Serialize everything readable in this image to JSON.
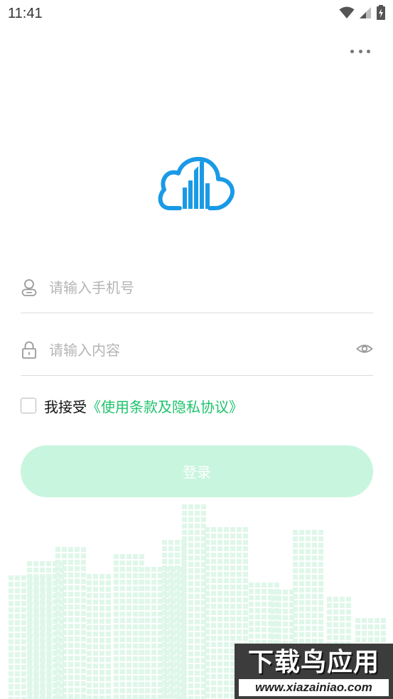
{
  "status_bar": {
    "time": "11:41",
    "icons": [
      "wifi-icon",
      "cellular-signal-icon",
      "battery-charging-icon"
    ]
  },
  "header": {
    "menu_icon": "more-horizontal-icon"
  },
  "logo": {
    "icon": "cloud-buildings-logo",
    "color": "#1a9ae6"
  },
  "form": {
    "phone": {
      "icon": "user-icon",
      "placeholder": "请输入手机号",
      "value": ""
    },
    "password": {
      "icon": "lock-icon",
      "placeholder": "请输入内容",
      "value": "",
      "toggle_icon": "eye-icon"
    },
    "agreement": {
      "checked": false,
      "prefix": "我接受",
      "link_text": "《使用条款及隐私协议》",
      "link_color": "#1ec36b"
    },
    "submit_label": "登录",
    "submit_color": "#c8f5de"
  },
  "watermark": {
    "title": "下载鸟应用",
    "url": "www.xiazainiao.com"
  }
}
